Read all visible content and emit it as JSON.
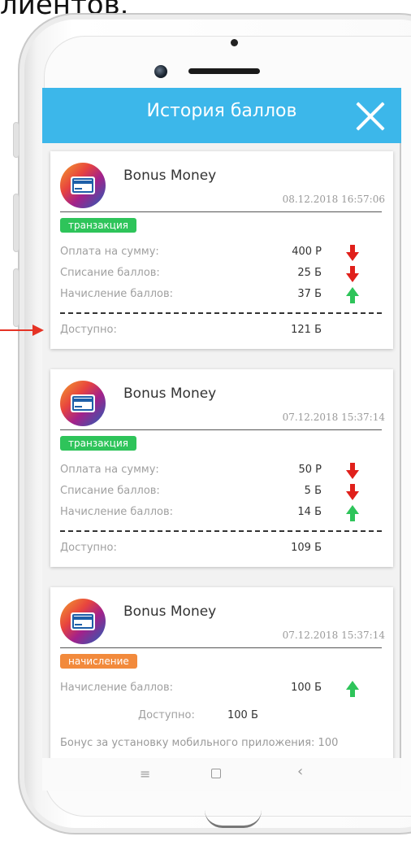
{
  "caption": "лиентов.",
  "header": {
    "title": "История баллов"
  },
  "cards": [
    {
      "brand": "Bonus Money",
      "date": "08.12.2018 16:57:06",
      "badge": "транзакция",
      "rows": [
        {
          "label": "Оплата на сумму:",
          "value": "400 Р",
          "direction": "down"
        },
        {
          "label": "Списание баллов:",
          "value": "25 Б",
          "direction": "down"
        },
        {
          "label": "Начисление баллов:",
          "value": "37 Б",
          "direction": "up"
        }
      ],
      "available_label": "Доступно:",
      "available_value": "121 Б"
    },
    {
      "brand": "Bonus Money",
      "date": "07.12.2018 15:37:14",
      "badge": "транзакция",
      "rows": [
        {
          "label": "Оплата на сумму:",
          "value": "50 Р",
          "direction": "down"
        },
        {
          "label": "Списание баллов:",
          "value": "5 Б",
          "direction": "down"
        },
        {
          "label": "Начисление баллов:",
          "value": "14 Б",
          "direction": "up"
        }
      ],
      "available_label": "Доступно:",
      "available_value": "109 Б"
    },
    {
      "brand": "Bonus Money",
      "date": "07.12.2018 15:37:14",
      "badge": "начисление",
      "rows": [
        {
          "label": "Начисление баллов:",
          "value": "100 Б",
          "direction": "up"
        }
      ],
      "available_label": "Доступно:",
      "available_value": "100 Б",
      "note": "Бонус за установку мобильного приложения: 100"
    }
  ],
  "navbar": {
    "menu": "≡",
    "back": "‹"
  },
  "colors": {
    "header": "#3cb7ea",
    "badge_transaction": "#2ec45a",
    "badge_accrual": "#f28a3c",
    "arrow_down": "#e0201b",
    "arrow_up": "#2ec45a",
    "pointer": "#e53325"
  },
  "icons": {
    "close": "close-icon",
    "card": "credit-card-icon",
    "down": "arrow-down-icon",
    "up": "arrow-up-icon"
  }
}
